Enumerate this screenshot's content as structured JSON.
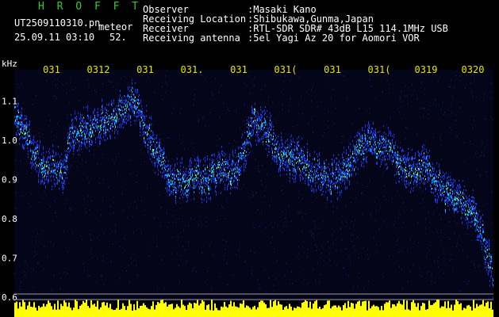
{
  "header": {
    "app_name": "H R O F F T",
    "filename": "UT2509110310.pn",
    "mode": "meteor",
    "date_time": "25.09.11 03:10",
    "extra": "52.",
    "fields": [
      {
        "label": "Observer",
        "value": ":Masaki Kano"
      },
      {
        "label": "Receiving Location",
        "value": ":Shibukawa,Gunma,Japan"
      },
      {
        "label": "Receiver",
        "value": ":RTL-SDR SDR# 43dB L15 114.1MHz USB"
      },
      {
        "label": "Receiving antenna",
        "value": ":5el Yagi Az 20 for Aomori VOR"
      }
    ]
  },
  "colors": {
    "background": "#000000",
    "title": "#37c837",
    "time_labels": "#e6e600",
    "signal_strong": "#00d0ff",
    "signal_weak": "#1a3cff",
    "spectrum_bar": "#ffff00"
  },
  "chart_data": {
    "type": "heatmap",
    "ylabel": "kHz",
    "yticks": [
      1.1,
      1.0,
      0.9,
      0.8,
      0.7,
      0.6
    ],
    "ylim": [
      0.59,
      1.18
    ],
    "xticks": [
      "031",
      "0312",
      "031",
      "031.",
      "031",
      "031(",
      "031",
      "031(",
      "0319",
      "0320"
    ],
    "trace": {
      "description_free_values": true,
      "minutes": [
        0,
        0.2,
        0.5,
        1.0,
        1.2,
        1.5,
        2.0,
        2.5,
        3.0,
        3.3,
        3.6,
        4.0,
        4.3,
        4.6,
        5.0,
        5.3,
        5.6,
        6.0,
        6.3,
        6.6,
        7.0,
        7.4,
        7.8,
        8.2,
        8.5,
        8.8,
        9.0,
        9.3,
        9.6,
        9.8,
        10.0
      ],
      "freq_khz": [
        1.08,
        1.02,
        0.95,
        0.92,
        1.02,
        1.03,
        1.06,
        1.1,
        0.96,
        0.9,
        0.9,
        0.9,
        0.93,
        0.92,
        1.05,
        1.02,
        0.96,
        0.95,
        0.92,
        0.9,
        0.94,
        1.0,
        0.98,
        0.92,
        0.94,
        0.9,
        0.86,
        0.85,
        0.82,
        0.74,
        0.64
      ]
    }
  }
}
